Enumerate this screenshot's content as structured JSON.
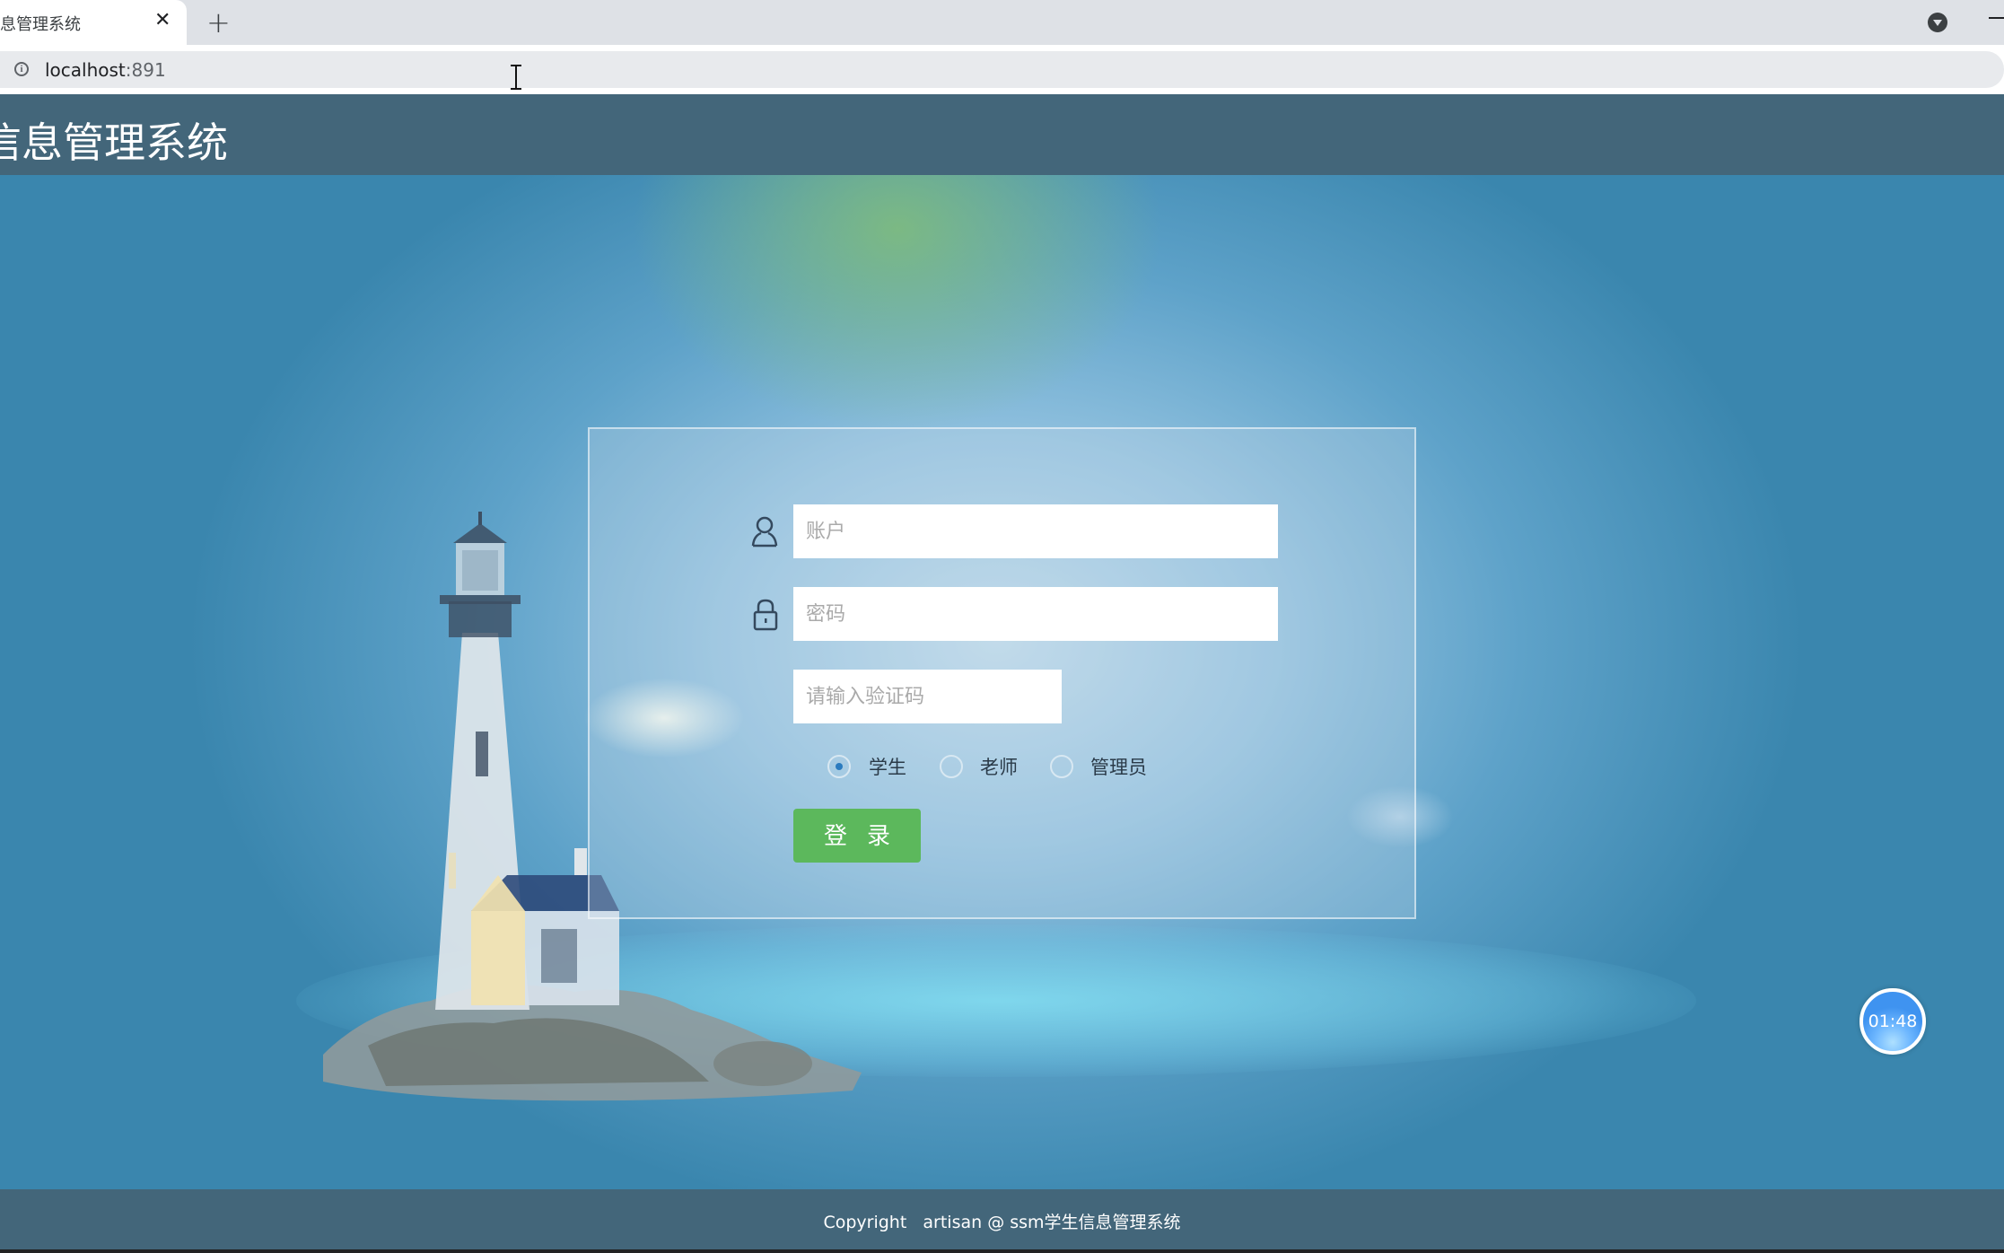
{
  "browser": {
    "tab_title": "息管理系统",
    "close_tab_glyph": "✕",
    "new_tab_glyph": "+",
    "url_host": "localhost",
    "url_port": ":891",
    "icons": {
      "site_info": "info-icon",
      "profile": "profile-dropdown-icon",
      "minimize": "minimize-icon"
    }
  },
  "header": {
    "title": "信息管理系统"
  },
  "login": {
    "account_placeholder": "账户",
    "account_value": "",
    "password_placeholder": "密码",
    "password_value": "",
    "captcha_placeholder": "请输入验证码",
    "captcha_value": "",
    "roles": [
      {
        "label": "学生",
        "checked": true
      },
      {
        "label": "老师",
        "checked": false
      },
      {
        "label": "管理员",
        "checked": false
      }
    ],
    "submit_label": "登录",
    "icons": {
      "account": "user-icon",
      "password": "lock-icon"
    },
    "accent_color": "#5cb85c"
  },
  "timer": {
    "value": "01:48"
  },
  "footer": {
    "text": "Copyright   artisan @ ssm学生信息管理系统"
  },
  "colors": {
    "header_bg": "#43667a",
    "footer_bg": "#43667a",
    "page_bg": "#3a86ae"
  }
}
